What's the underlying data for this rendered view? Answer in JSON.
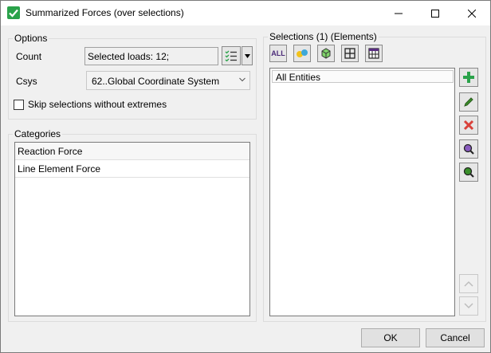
{
  "window": {
    "title": "Summarized Forces (over selections)"
  },
  "options": {
    "group_label": "Options",
    "count_label": "Count",
    "count_value": "Selected loads: 12;",
    "csys_label": "Csys",
    "csys_value": "62..Global Coordinate System",
    "skip_label": "Skip selections without extremes",
    "skip_checked": false
  },
  "categories": {
    "group_label": "Categories",
    "items": [
      "Reaction Force",
      "Line Element Force"
    ]
  },
  "selections": {
    "group_label": "Selections (1) (Elements)",
    "toolbar": {
      "all_label": "ALL"
    },
    "list_header": "All Entities"
  },
  "buttons": {
    "ok": "OK",
    "cancel": "Cancel"
  },
  "colors": {
    "accent_green": "#2aa24a",
    "delete_red": "#d9413a",
    "edit_green": "#3a8f2a",
    "search_purple": "#5a2d82"
  },
  "icons": {
    "app": "check-icon",
    "minimize": "minimize-icon",
    "maximize": "maximize-icon",
    "close": "close-icon"
  }
}
